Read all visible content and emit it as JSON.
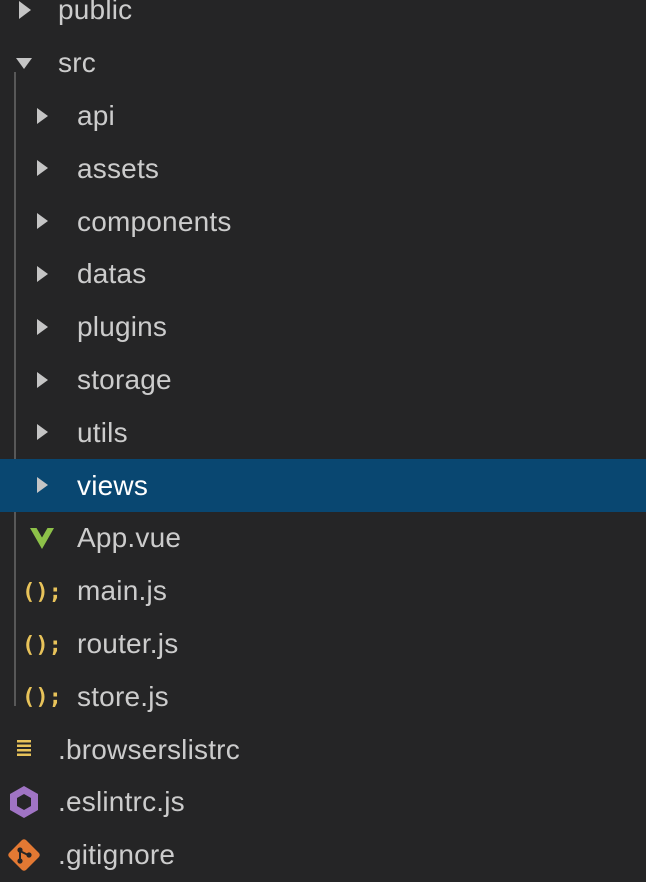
{
  "explorer": {
    "items": [
      {
        "label": "public",
        "kind": "folder",
        "expanded": false,
        "depth": 0,
        "icon": "chevron-right-icon"
      },
      {
        "label": "src",
        "kind": "folder",
        "expanded": true,
        "depth": 0,
        "icon": "chevron-down-icon"
      },
      {
        "label": "api",
        "kind": "folder",
        "expanded": false,
        "depth": 1,
        "icon": "chevron-right-icon"
      },
      {
        "label": "assets",
        "kind": "folder",
        "expanded": false,
        "depth": 1,
        "icon": "chevron-right-icon"
      },
      {
        "label": "components",
        "kind": "folder",
        "expanded": false,
        "depth": 1,
        "icon": "chevron-right-icon"
      },
      {
        "label": "datas",
        "kind": "folder",
        "expanded": false,
        "depth": 1,
        "icon": "chevron-right-icon"
      },
      {
        "label": "plugins",
        "kind": "folder",
        "expanded": false,
        "depth": 1,
        "icon": "chevron-right-icon"
      },
      {
        "label": "storage",
        "kind": "folder",
        "expanded": false,
        "depth": 1,
        "icon": "chevron-right-icon"
      },
      {
        "label": "utils",
        "kind": "folder",
        "expanded": false,
        "depth": 1,
        "icon": "chevron-right-icon"
      },
      {
        "label": "views",
        "kind": "folder",
        "expanded": false,
        "depth": 1,
        "icon": "chevron-right-icon",
        "selected": true
      },
      {
        "label": "App.vue",
        "kind": "file",
        "depth": 1,
        "icon": "vue-icon"
      },
      {
        "label": "main.js",
        "kind": "file",
        "depth": 1,
        "icon": "javascript-icon"
      },
      {
        "label": "router.js",
        "kind": "file",
        "depth": 1,
        "icon": "javascript-icon"
      },
      {
        "label": "store.js",
        "kind": "file",
        "depth": 1,
        "icon": "javascript-icon"
      },
      {
        "label": ".browserslistrc",
        "kind": "file",
        "depth": 0,
        "icon": "text-lines-icon"
      },
      {
        "label": ".eslintrc.js",
        "kind": "file",
        "depth": 0,
        "icon": "eslint-icon"
      },
      {
        "label": ".gitignore",
        "kind": "file",
        "depth": 0,
        "icon": "git-icon"
      }
    ]
  },
  "colors": {
    "background": "#252526",
    "selection": "#094771",
    "text": "#cccccc",
    "chevron": "#c5c5c5",
    "vue": "#8dc149",
    "javascript": "#e8c35a",
    "eslint": "#a074c4",
    "git": "#e37933"
  }
}
